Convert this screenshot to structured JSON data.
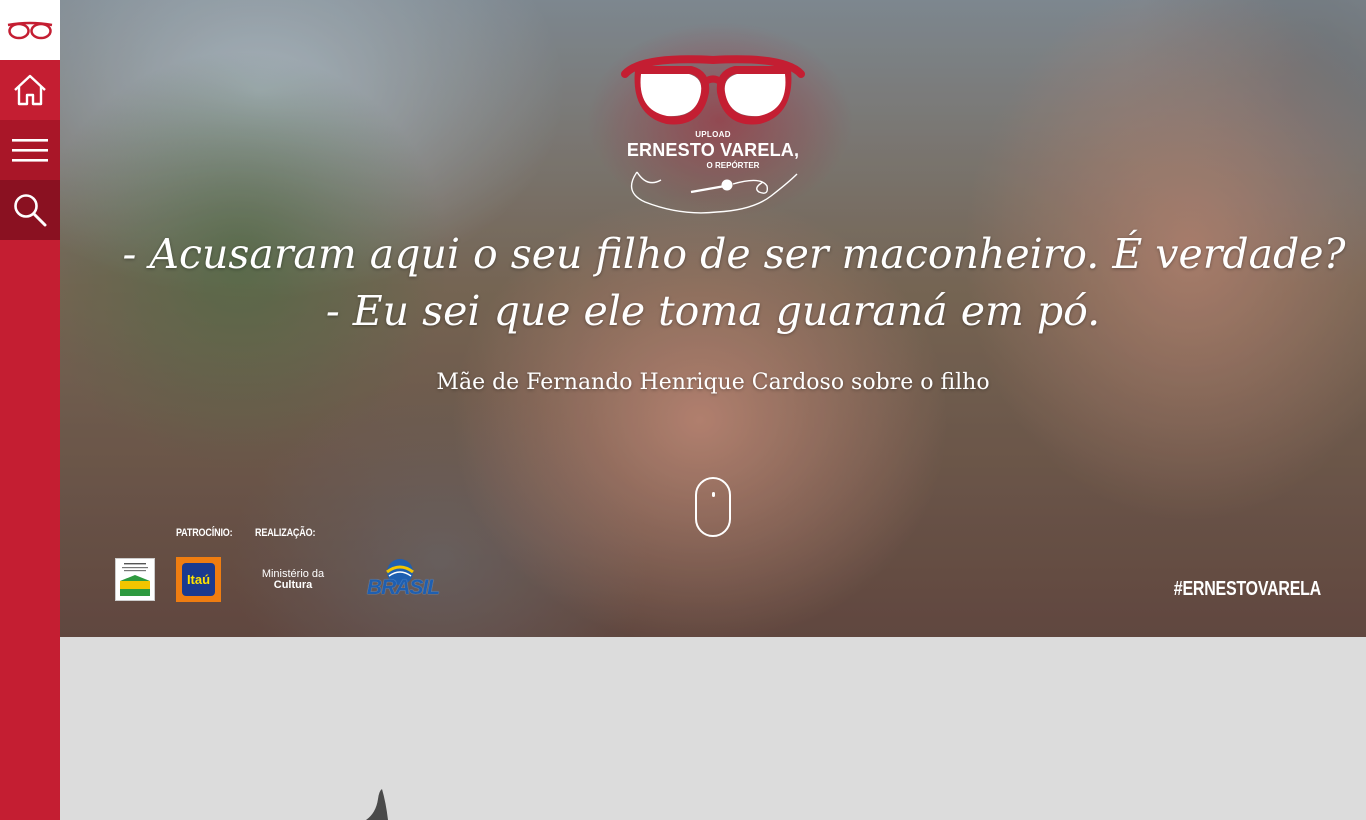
{
  "sidebar": {
    "logo_icon": "glasses-icon",
    "items": [
      {
        "name": "home",
        "icon": "home-icon"
      },
      {
        "name": "menu",
        "icon": "menu-icon"
      },
      {
        "name": "search",
        "icon": "search-icon"
      }
    ]
  },
  "brand": {
    "upload": "UPLOAD",
    "name": "ERNESTO VARELA,",
    "subtitle": "O REPÓRTER",
    "icons": [
      "glasses-icon",
      "microphone-icon"
    ]
  },
  "hero": {
    "quote_line1": "- Acusaram aqui o seu filho de ser maconheiro. É verdade?",
    "quote_line2": "- Eu sei que ele toma guaraná em pó.",
    "attribution": "Mãe de Fernando Henrique Cardoso sobre o filho",
    "scroll_icon": "mouse-scroll-icon"
  },
  "sponsors": {
    "patrocinio_label": "PATROCÍNIO:",
    "realizacao_label": "REALIZAÇÃO:",
    "itau_text": "Itaú",
    "minc_line1": "Ministério da",
    "minc_line2": "Cultura",
    "brasil_text": "BRASIL"
  },
  "hashtag": "#ERNESTOVARELA",
  "colors": {
    "accent": "#c41e32",
    "accent_dark": "#8a1121",
    "lower_bg": "#dcdcdc",
    "itau_orange": "#ef7d11",
    "itau_blue": "#1a3a8f"
  }
}
